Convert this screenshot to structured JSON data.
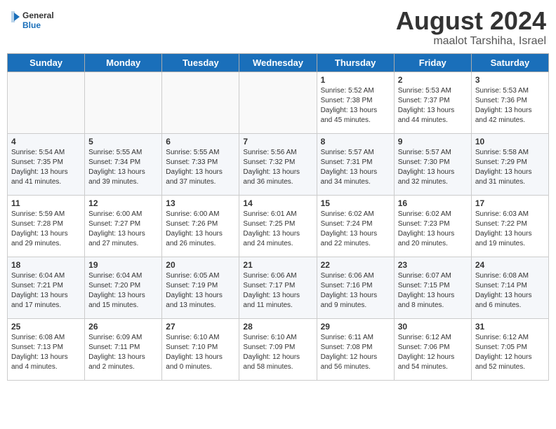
{
  "header": {
    "logo_general": "General",
    "logo_blue": "Blue",
    "month_year": "August 2024",
    "location": "maalot Tarshiha, Israel"
  },
  "weekdays": [
    "Sunday",
    "Monday",
    "Tuesday",
    "Wednesday",
    "Thursday",
    "Friday",
    "Saturday"
  ],
  "weeks": [
    [
      {
        "day": "",
        "empty": true
      },
      {
        "day": "",
        "empty": true
      },
      {
        "day": "",
        "empty": true
      },
      {
        "day": "",
        "empty": true
      },
      {
        "day": "1",
        "sunrise": "5:52 AM",
        "sunset": "7:38 PM",
        "daylight": "13 hours and 45 minutes."
      },
      {
        "day": "2",
        "sunrise": "5:53 AM",
        "sunset": "7:37 PM",
        "daylight": "13 hours and 44 minutes."
      },
      {
        "day": "3",
        "sunrise": "5:53 AM",
        "sunset": "7:36 PM",
        "daylight": "13 hours and 42 minutes."
      }
    ],
    [
      {
        "day": "4",
        "sunrise": "5:54 AM",
        "sunset": "7:35 PM",
        "daylight": "13 hours and 41 minutes."
      },
      {
        "day": "5",
        "sunrise": "5:55 AM",
        "sunset": "7:34 PM",
        "daylight": "13 hours and 39 minutes."
      },
      {
        "day": "6",
        "sunrise": "5:55 AM",
        "sunset": "7:33 PM",
        "daylight": "13 hours and 37 minutes."
      },
      {
        "day": "7",
        "sunrise": "5:56 AM",
        "sunset": "7:32 PM",
        "daylight": "13 hours and 36 minutes."
      },
      {
        "day": "8",
        "sunrise": "5:57 AM",
        "sunset": "7:31 PM",
        "daylight": "13 hours and 34 minutes."
      },
      {
        "day": "9",
        "sunrise": "5:57 AM",
        "sunset": "7:30 PM",
        "daylight": "13 hours and 32 minutes."
      },
      {
        "day": "10",
        "sunrise": "5:58 AM",
        "sunset": "7:29 PM",
        "daylight": "13 hours and 31 minutes."
      }
    ],
    [
      {
        "day": "11",
        "sunrise": "5:59 AM",
        "sunset": "7:28 PM",
        "daylight": "13 hours and 29 minutes."
      },
      {
        "day": "12",
        "sunrise": "6:00 AM",
        "sunset": "7:27 PM",
        "daylight": "13 hours and 27 minutes."
      },
      {
        "day": "13",
        "sunrise": "6:00 AM",
        "sunset": "7:26 PM",
        "daylight": "13 hours and 26 minutes."
      },
      {
        "day": "14",
        "sunrise": "6:01 AM",
        "sunset": "7:25 PM",
        "daylight": "13 hours and 24 minutes."
      },
      {
        "day": "15",
        "sunrise": "6:02 AM",
        "sunset": "7:24 PM",
        "daylight": "13 hours and 22 minutes."
      },
      {
        "day": "16",
        "sunrise": "6:02 AM",
        "sunset": "7:23 PM",
        "daylight": "13 hours and 20 minutes."
      },
      {
        "day": "17",
        "sunrise": "6:03 AM",
        "sunset": "7:22 PM",
        "daylight": "13 hours and 19 minutes."
      }
    ],
    [
      {
        "day": "18",
        "sunrise": "6:04 AM",
        "sunset": "7:21 PM",
        "daylight": "13 hours and 17 minutes."
      },
      {
        "day": "19",
        "sunrise": "6:04 AM",
        "sunset": "7:20 PM",
        "daylight": "13 hours and 15 minutes."
      },
      {
        "day": "20",
        "sunrise": "6:05 AM",
        "sunset": "7:19 PM",
        "daylight": "13 hours and 13 minutes."
      },
      {
        "day": "21",
        "sunrise": "6:06 AM",
        "sunset": "7:17 PM",
        "daylight": "13 hours and 11 minutes."
      },
      {
        "day": "22",
        "sunrise": "6:06 AM",
        "sunset": "7:16 PM",
        "daylight": "13 hours and 9 minutes."
      },
      {
        "day": "23",
        "sunrise": "6:07 AM",
        "sunset": "7:15 PM",
        "daylight": "13 hours and 8 minutes."
      },
      {
        "day": "24",
        "sunrise": "6:08 AM",
        "sunset": "7:14 PM",
        "daylight": "13 hours and 6 minutes."
      }
    ],
    [
      {
        "day": "25",
        "sunrise": "6:08 AM",
        "sunset": "7:13 PM",
        "daylight": "13 hours and 4 minutes."
      },
      {
        "day": "26",
        "sunrise": "6:09 AM",
        "sunset": "7:11 PM",
        "daylight": "13 hours and 2 minutes."
      },
      {
        "day": "27",
        "sunrise": "6:10 AM",
        "sunset": "7:10 PM",
        "daylight": "13 hours and 0 minutes."
      },
      {
        "day": "28",
        "sunrise": "6:10 AM",
        "sunset": "7:09 PM",
        "daylight": "12 hours and 58 minutes."
      },
      {
        "day": "29",
        "sunrise": "6:11 AM",
        "sunset": "7:08 PM",
        "daylight": "12 hours and 56 minutes."
      },
      {
        "day": "30",
        "sunrise": "6:12 AM",
        "sunset": "7:06 PM",
        "daylight": "12 hours and 54 minutes."
      },
      {
        "day": "31",
        "sunrise": "6:12 AM",
        "sunset": "7:05 PM",
        "daylight": "12 hours and 52 minutes."
      }
    ]
  ]
}
